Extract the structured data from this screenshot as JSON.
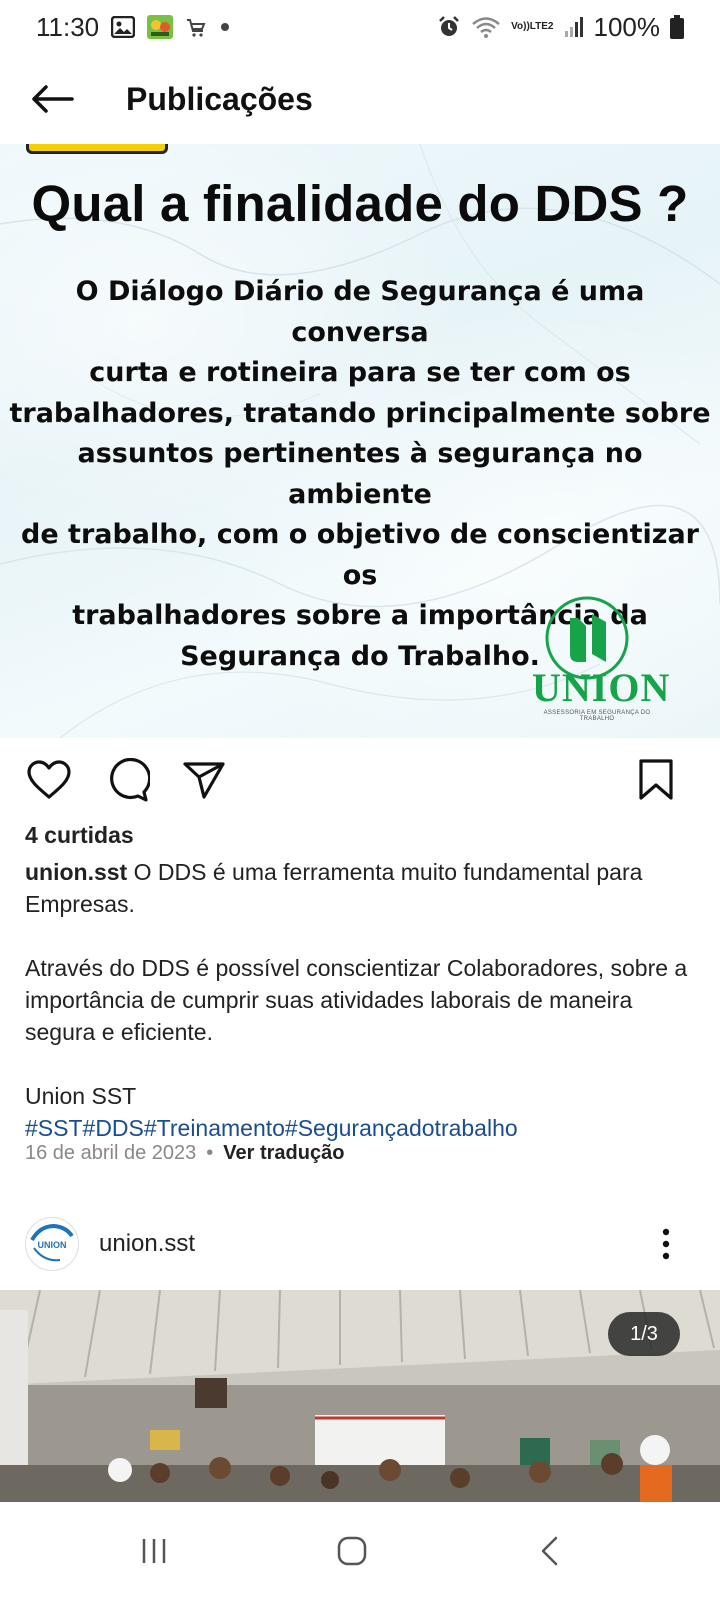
{
  "status_bar": {
    "time": "11:30",
    "notification_icons": [
      "gallery-icon",
      "game-icon",
      "shopping-cart-icon",
      "dot-icon"
    ],
    "lte_top": "Vo))",
    "lte_bottom": "LTE2",
    "battery": "100%"
  },
  "header": {
    "title": "Publicações"
  },
  "post1": {
    "headline": "Qual a finalidade do DDS ?",
    "body_lines": [
      "O Diálogo Diário de Segurança é uma conversa",
      "curta e rotineira para se ter com os",
      "trabalhadores, tratando principalmente sobre",
      "assuntos pertinentes à segurança no ambiente",
      "de trabalho, com o objetivo de conscientizar os",
      "trabalhadores sobre a importância da",
      "Segurança do Trabalho."
    ],
    "logo_word": "UNION",
    "logo_sub": "ASSESSORIA EM SEGURANÇA DO TRABALHO",
    "likes": "4 curtidas",
    "caption_user": "union.sst",
    "caption_first": "O DDS é uma ferramenta muito fundamental para Empresas.",
    "caption_second": "Através do DDS é possível conscientizar Colaboradores, sobre a importância de cumprir suas atividades laborais de maneira segura e eficiente.",
    "caption_sign": "Union SST",
    "hashtags": "#SST#DDS#Treinamento#Segurançadotrabalho",
    "date": "16 de abril de 2023",
    "separator": "•",
    "translate": "Ver tradução"
  },
  "post2": {
    "username": "union.sst",
    "avatar_text": "UNION",
    "counter": "1/3"
  },
  "colors": {
    "accent_green": "#17a34a",
    "hashtag_blue": "#1a4d8f",
    "background": "#ffffff"
  }
}
